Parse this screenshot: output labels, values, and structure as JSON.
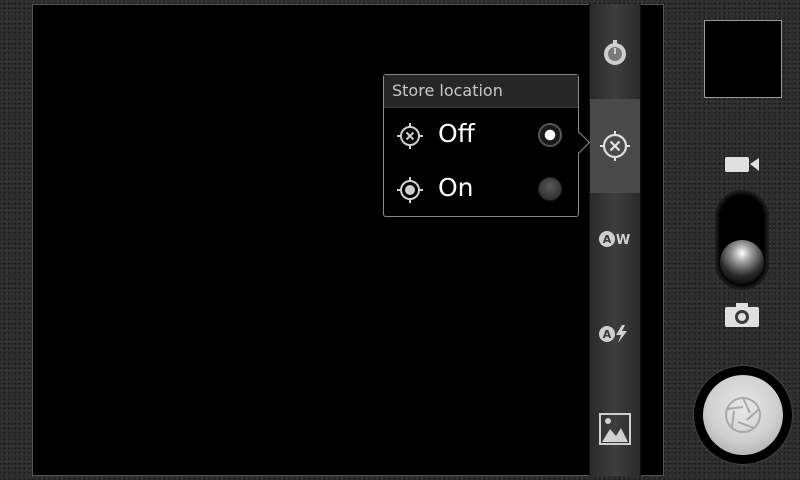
{
  "app": {
    "name": "Camera"
  },
  "settings_bar": {
    "items": [
      {
        "name": "self-timer-icon"
      },
      {
        "name": "location-off-icon",
        "selected": true
      },
      {
        "name": "white-balance-auto-icon"
      },
      {
        "name": "flash-auto-icon"
      },
      {
        "name": "scene-icon"
      }
    ]
  },
  "popup": {
    "title": "Store location",
    "options": [
      {
        "label": "Off",
        "icon": "location-off-icon",
        "checked": true
      },
      {
        "label": "On",
        "icon": "location-on-icon",
        "checked": false
      }
    ]
  },
  "mode": {
    "current": "camera",
    "options": [
      "video",
      "camera"
    ]
  },
  "colors": {
    "background": "#2b2b2b",
    "viewfinder": "#000000",
    "popup_border": "#8a8a8a"
  }
}
